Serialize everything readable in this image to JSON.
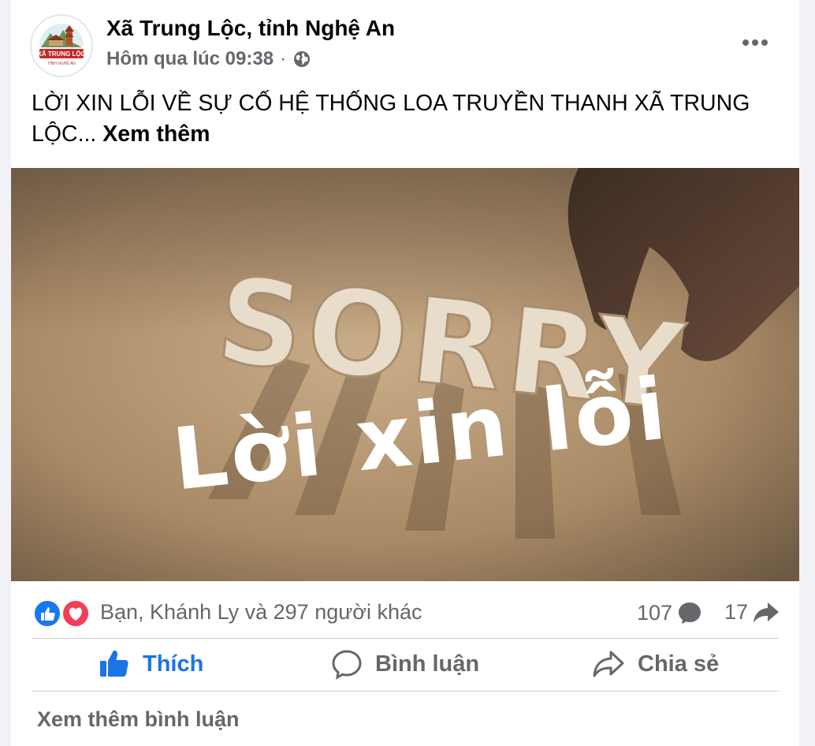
{
  "post": {
    "page_name": "Xã Trung Lộc, tỉnh Nghệ An",
    "timestamp": "Hôm qua lúc 09:38",
    "separator": "·",
    "privacy_icon": "globe-icon",
    "avatar_text": {
      "line1": "XÃ TRUNG LỘC",
      "line2": "TỈNH NGHỆ AN"
    },
    "text": "LỜI XIN LỖI VỀ SỰ CỐ HỆ THỐNG LOA TRUYỀN THANH XÃ TRUNG LỘC...",
    "see_more": "Xem thêm",
    "image": {
      "word_top": "SORRY",
      "word_bottom": "Lời xin lỗi"
    }
  },
  "stats": {
    "reactions_text": "Bạn, Khánh Ly và 297 người khác",
    "comments_count": "107",
    "shares_count": "17"
  },
  "actions": {
    "like": "Thích",
    "comment": "Bình luận",
    "share": "Chia sẻ"
  },
  "footer": {
    "view_more_comments": "Xem thêm bình luận"
  },
  "colors": {
    "accent": "#1b74e4",
    "like_blue": "#1877f2",
    "love_red": "#f33e58",
    "secondary_text": "#65676b"
  }
}
